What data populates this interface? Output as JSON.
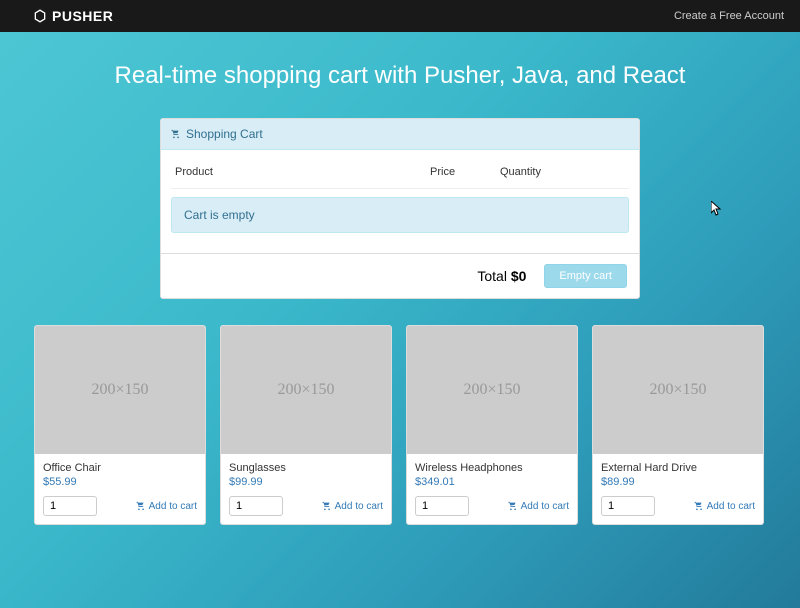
{
  "nav": {
    "brand": "PUSHER",
    "cta": "Create a Free Account"
  },
  "title": "Real-time shopping cart with Pusher, Java, and React",
  "cart": {
    "header": "Shopping Cart",
    "columns": {
      "product": "Product",
      "price": "Price",
      "qty": "Quantity"
    },
    "empty_message": "Cart is empty",
    "total_label": "Total",
    "total_value": "$0",
    "empty_button": "Empty cart"
  },
  "placeholder_text": "200×150",
  "add_label": "Add to cart",
  "products": [
    {
      "name": "Office Chair",
      "price": "$55.99",
      "qty": "1"
    },
    {
      "name": "Sunglasses",
      "price": "$99.99",
      "qty": "1"
    },
    {
      "name": "Wireless Headphones",
      "price": "$349.01",
      "qty": "1"
    },
    {
      "name": "External Hard Drive",
      "price": "$89.99",
      "qty": "1"
    }
  ]
}
